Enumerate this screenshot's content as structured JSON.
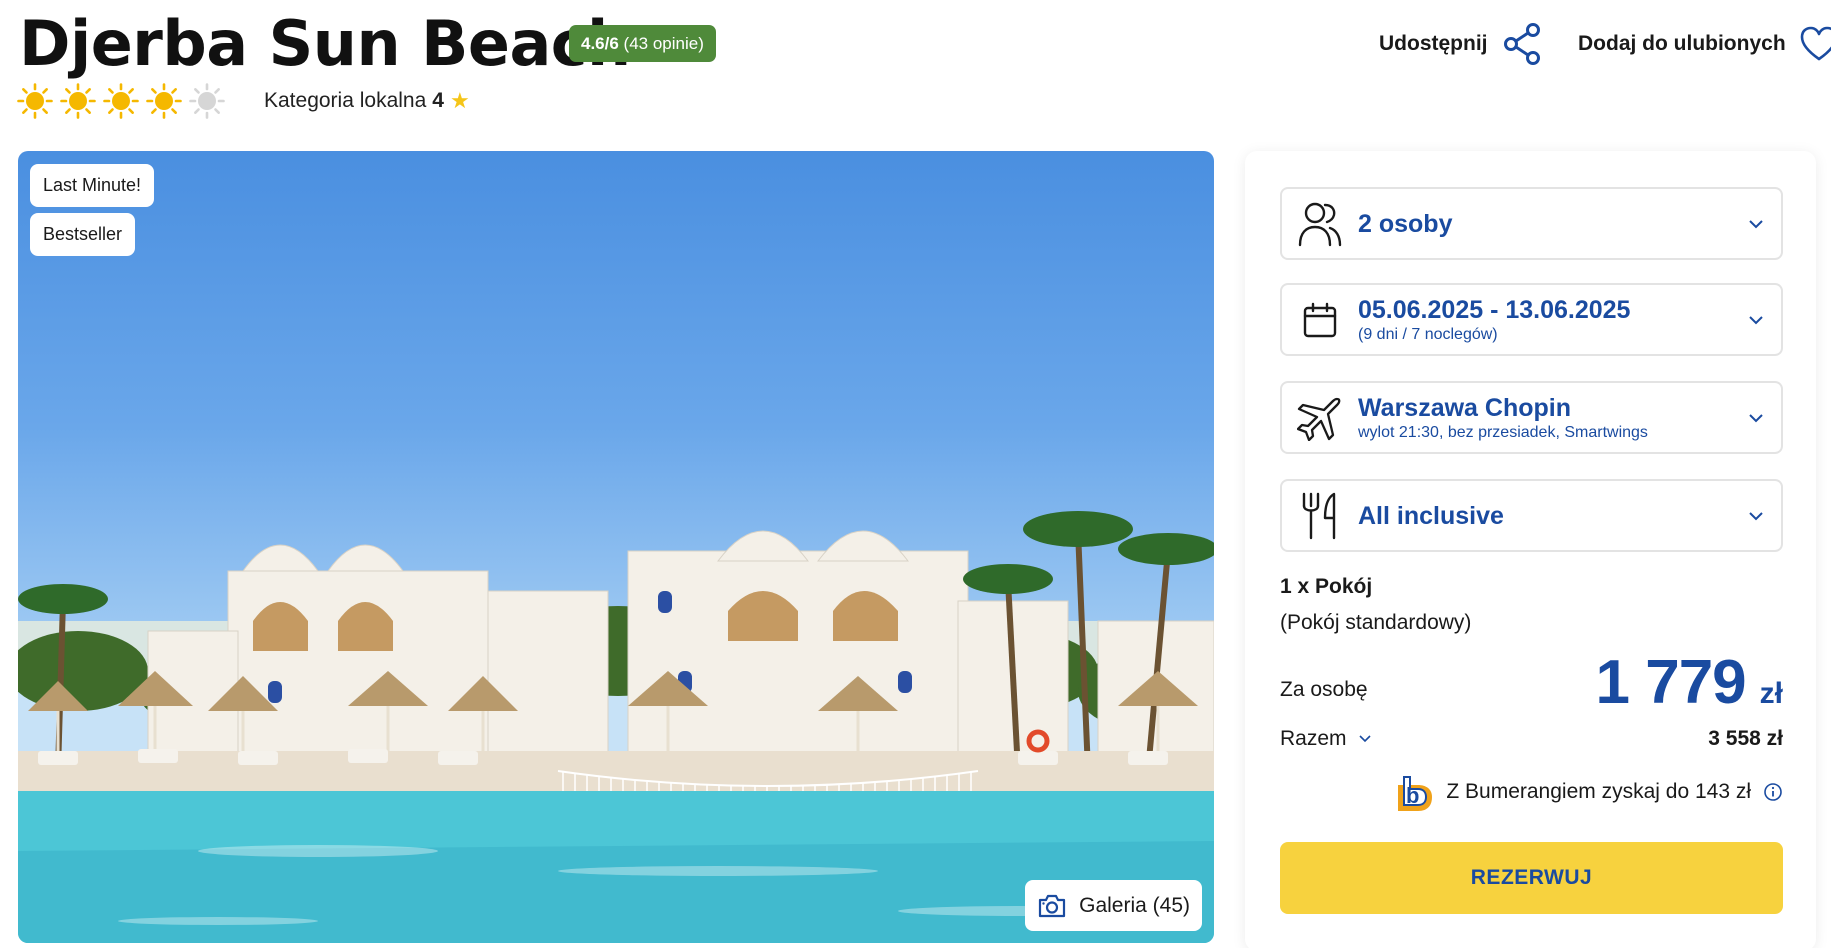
{
  "header": {
    "title": "Djerba Sun Beach",
    "rating": {
      "score": "4.6/6",
      "reviews": "(43 opinie)"
    },
    "sun_rating": {
      "filled": 4,
      "max": 5
    },
    "local_category": {
      "label": "Kategoria lokalna",
      "value": "4",
      "icon": "star-icon"
    },
    "share_label": "Udostępnij",
    "favorite_label": "Dodaj do ulubionych"
  },
  "gallery": {
    "tags": [
      "Last Minute!",
      "Bestseller"
    ],
    "gallery_button": "Galeria (45)"
  },
  "booking": {
    "people": {
      "main": "2 osoby",
      "icon": "people-icon"
    },
    "dates": {
      "main": "05.06.2025 - 13.06.2025",
      "sub": "(9 dni / 7 noclegów)",
      "icon": "calendar-icon"
    },
    "flight": {
      "main": "Warszawa Chopin",
      "sub": "wylot 21:30, bez przesiadek, Smartwings",
      "icon": "plane-icon"
    },
    "board": {
      "main": "All inclusive",
      "icon": "cutlery-icon"
    },
    "room_title": "1 x Pokój",
    "room_type": "(Pokój standardowy)",
    "per_person_label": "Za osobę",
    "price": "1 779",
    "currency": "zł",
    "total_label": "Razem",
    "total_value": "3 558 zł",
    "bumerang_text": "Z Bumerangiem zyskaj do 143 zł",
    "book_button": "REZERWUJ"
  },
  "colors": {
    "accent": "#1a4ba0",
    "rating_badge": "#4f8a3a",
    "book_button": "#f7d23e",
    "sun": "#f5b800"
  }
}
